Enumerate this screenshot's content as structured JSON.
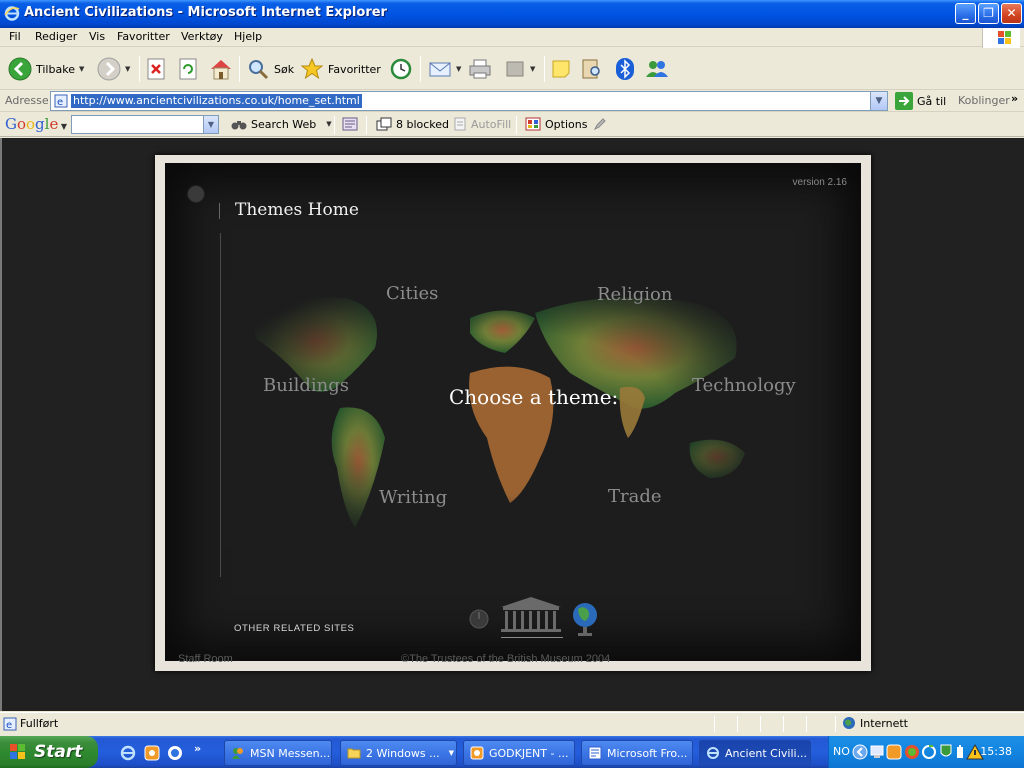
{
  "window": {
    "title": "Ancient Civilizations - Microsoft Internet Explorer",
    "minimize": "_",
    "maximize": "❐",
    "close": "✕"
  },
  "menu": [
    "Fil",
    "Rediger",
    "Vis",
    "Favoritter",
    "Verktøy",
    "Hjelp"
  ],
  "toolbar": {
    "back_label": "Tilbake",
    "search_label": "Søk",
    "favorites_label": "Favoritter"
  },
  "address": {
    "label": "Adresse",
    "url": "http://www.ancientcivilizations.co.uk/home_set.html",
    "go_label": "Gå til",
    "links_label": "Koblinger",
    "links_chevron": "»"
  },
  "google_toolbar": {
    "logo": "Google",
    "search_value": "",
    "search_web_label": "Search Web",
    "blocked_label": "8 blocked",
    "autofill_label": "AutoFill",
    "options_label": "Options"
  },
  "page": {
    "version": "version 2.16",
    "themes_home": "Themes Home",
    "choose_theme": "Choose a theme:",
    "themes": [
      "Cities",
      "Religion",
      "Buildings",
      "Technology",
      "Writing",
      "Trade"
    ],
    "other_related_sites": "OTHER RELATED SITES",
    "staff_room": "Staff Room",
    "copyright": "©The Trustees of the British Museum 2004"
  },
  "statusbar": {
    "status": "Fullført",
    "zone": "Internett"
  },
  "taskbar": {
    "start_label": "Start",
    "quicklaunch_chevron": "»",
    "tasks": [
      {
        "label": "MSN Messen...",
        "active": false
      },
      {
        "label": "2 Windows ...",
        "active": false
      },
      {
        "label": "GODKJENT - ...",
        "active": false
      },
      {
        "label": "Microsoft Fro...",
        "active": false
      },
      {
        "label": "Ancient Civili...",
        "active": true
      }
    ],
    "tray_text": "NO",
    "clock": "15:38"
  },
  "colors": {
    "title_bar": "#0054e3",
    "content_bg": "#212121",
    "start_green": "#2f8a2f"
  }
}
